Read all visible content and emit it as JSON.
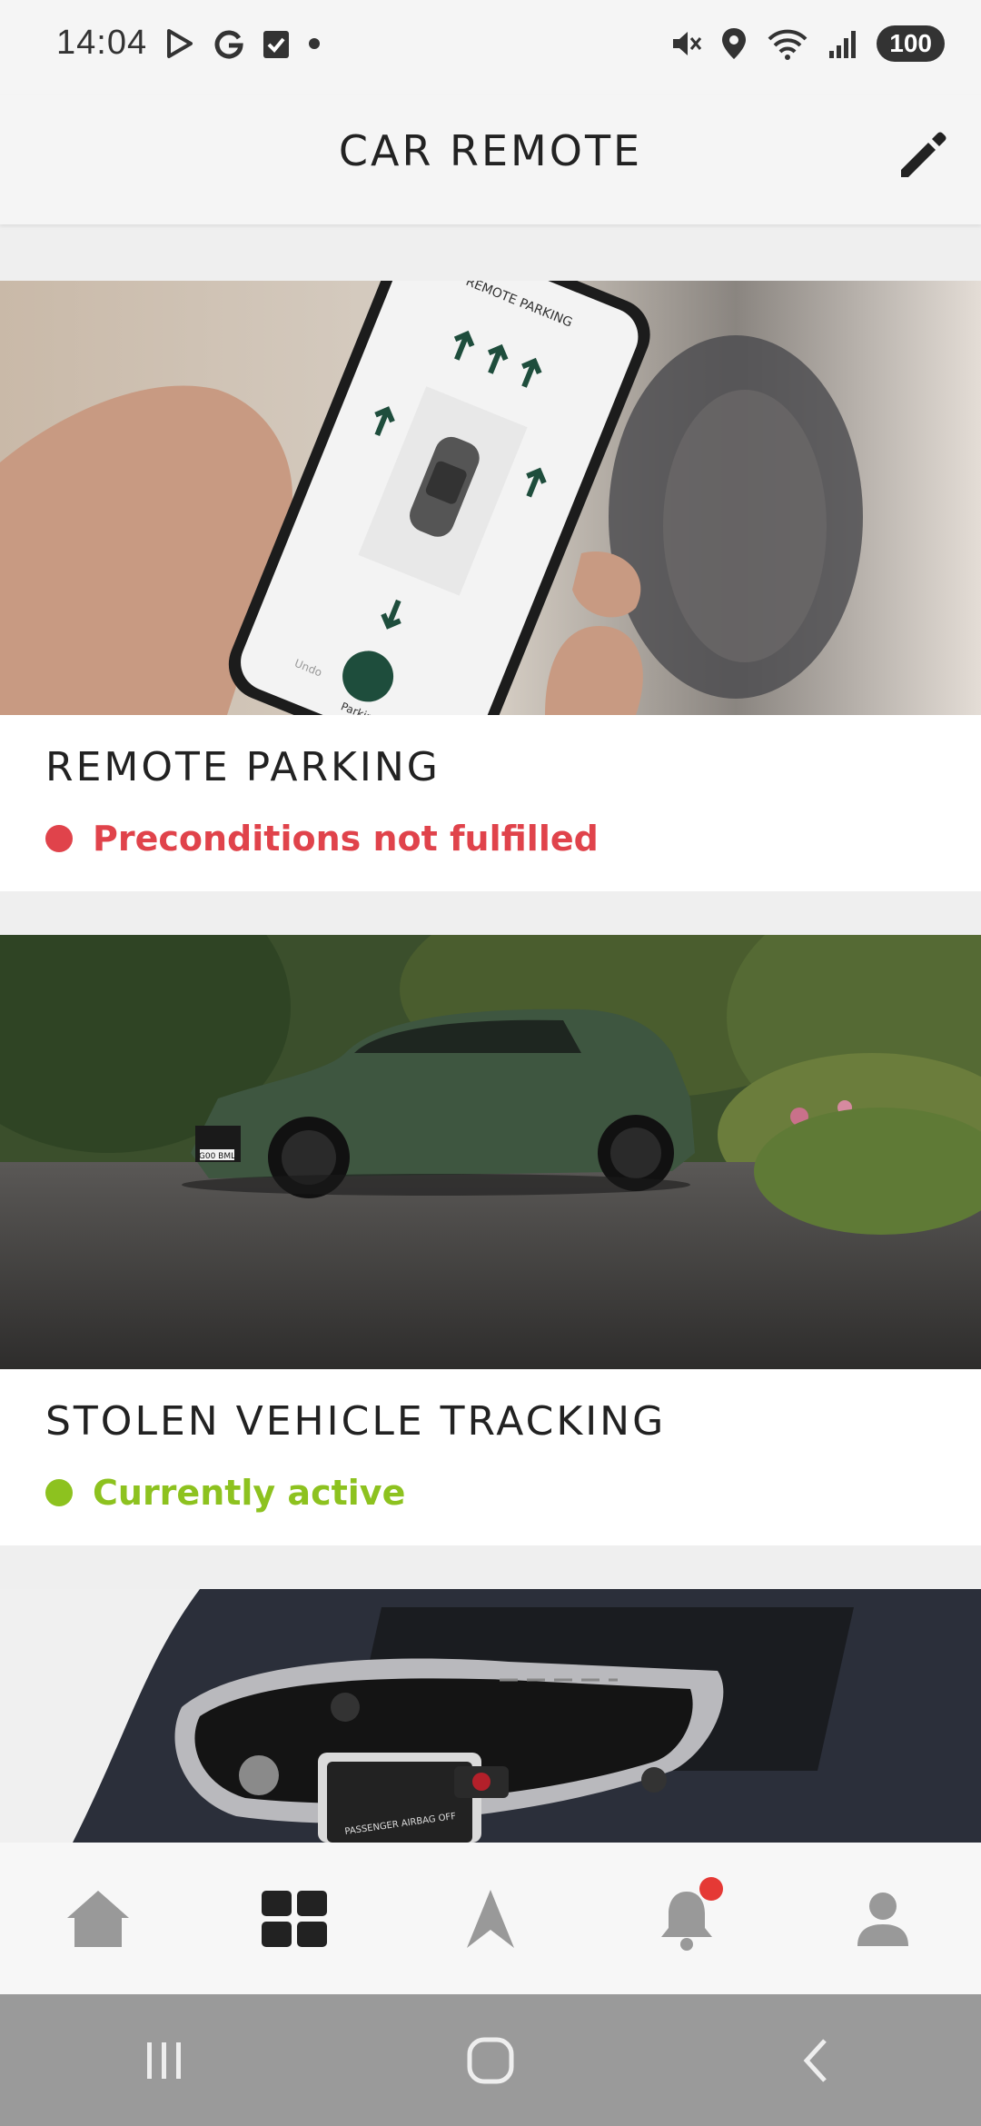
{
  "status_bar": {
    "time": "14:04",
    "battery": "100",
    "left_icons": [
      "play-store-icon",
      "google-icon",
      "checkbox-icon",
      "dot-icon"
    ],
    "right_icons": [
      "mute-icon",
      "location-icon",
      "wifi-icon",
      "signal-icon"
    ]
  },
  "header": {
    "title": "CAR REMOTE",
    "edit_icon": "pencil-icon"
  },
  "cards": [
    {
      "title": "REMOTE PARKING",
      "status": "Preconditions not fulfilled",
      "status_color": "#e0434b",
      "image_app_title": "REMOTE PARKING",
      "image_labels": [
        "Undo",
        "Parking"
      ]
    },
    {
      "title": "STOLEN VEHICLE TRACKING",
      "status": "Currently active",
      "status_color": "#8dc21f",
      "plate": "G00 BML"
    },
    {
      "title": "",
      "status": "",
      "image_small_text": "PASSENGER AIRBAG OFF"
    }
  ],
  "bottom_nav": {
    "items": [
      "home-icon",
      "dashboard-icon",
      "navigation-icon",
      "notifications-icon",
      "profile-icon"
    ],
    "active": "dashboard-icon",
    "notification_badge_color": "#e53935"
  },
  "system_nav": [
    "recents-button",
    "home-button",
    "back-button"
  ]
}
